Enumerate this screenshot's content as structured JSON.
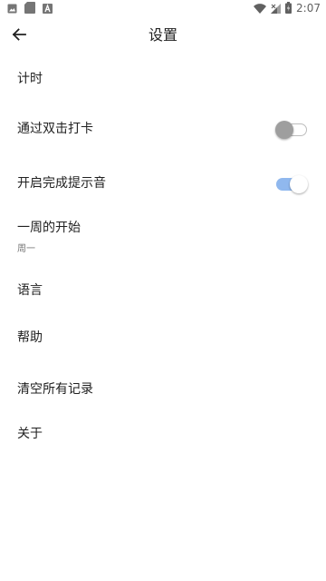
{
  "status_bar": {
    "time": "2:07",
    "left_icons": [
      "image-icon",
      "sd-card-icon",
      "font-icon"
    ],
    "right_icons": [
      "wifi-icon",
      "signal-icon",
      "battery-icon"
    ]
  },
  "header": {
    "title": "设置",
    "back_icon": "arrow-left-icon"
  },
  "settings": {
    "timer": "计时",
    "double_tap_checkin": {
      "label": "通过双击打卡",
      "enabled": false
    },
    "completion_sound": {
      "label": "开启完成提示音",
      "enabled": true
    },
    "week_start": {
      "label": "一周的开始",
      "value": "周一"
    },
    "language": "语言",
    "help": "帮助",
    "clear_all": "清空所有记录",
    "about": "关于"
  },
  "colors": {
    "switch_on_track": "#90b8ee",
    "switch_off_thumb": "#9e9e9e"
  }
}
